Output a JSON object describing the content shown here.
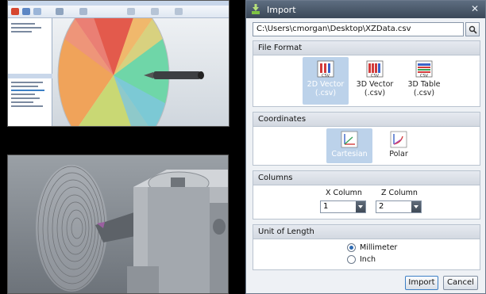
{
  "dialog": {
    "title": "Import",
    "file_path": "C:\\Users\\cmorgan\\Desktop\\XZData.csv",
    "close_glyph": "✕",
    "sections": {
      "file_format": "File Format",
      "coordinates": "Coordinates",
      "columns": "Columns",
      "unit_of_length": "Unit of Length"
    },
    "formats": [
      {
        "line1": "2D Vector",
        "line2": "(.csv)",
        "selected": true,
        "icon": "vector-2d-icon"
      },
      {
        "line1": "3D Vector",
        "line2": "(.csv)",
        "selected": false,
        "icon": "vector-3d-icon"
      },
      {
        "line1": "3D Table",
        "line2": "(.csv)",
        "selected": false,
        "icon": "table-3d-icon"
      }
    ],
    "coordinates": [
      {
        "label": "Cartesian",
        "selected": true,
        "icon": "cartesian-axes-icon"
      },
      {
        "label": "Polar",
        "selected": false,
        "icon": "polar-axes-icon"
      }
    ],
    "columns": {
      "x_label": "X Column",
      "x_value": "1",
      "z_label": "Z Column",
      "z_value": "2"
    },
    "units": [
      {
        "label": "Millimeter",
        "selected": true
      },
      {
        "label": "Inch",
        "selected": false
      }
    ],
    "buttons": {
      "import": "Import",
      "cancel": "Cancel"
    }
  },
  "colors": {
    "title_bar": "#3b4858",
    "selection": "#bcd2ea",
    "accent": "#2f6bb3"
  }
}
